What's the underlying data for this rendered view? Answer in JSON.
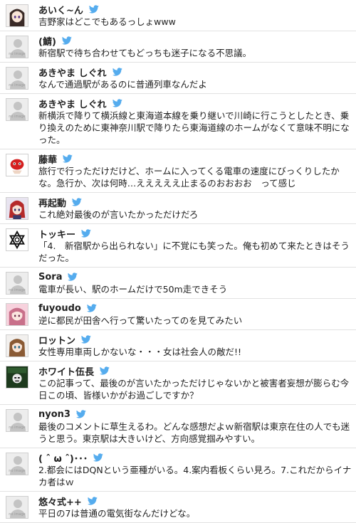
{
  "no_image_label": "no image",
  "tweets": [
    {
      "name": "あいく~ん",
      "text": "吉野家はどこでもあるっしょwww",
      "avatar": "anime-girl"
    },
    {
      "name": "(鯖)",
      "text": "新宿駅で待ち合わせてもどっちも迷子になる不思議。",
      "avatar": "noimage"
    },
    {
      "name": "あきやま しぐれ",
      "text": "なんで通過駅があるのに普通列車なんだよ",
      "avatar": "noimage"
    },
    {
      "name": "あきやま しぐれ",
      "text": "新横浜で降りて横浜線と東海道本線を乗り継いで川崎に行こうとしたとき、乗り換えのために東神奈川駅で降りたら東海道線のホームがなくて意味不明になった。",
      "avatar": "noimage"
    },
    {
      "name": "藤華",
      "text": "旅行で行っただけだけど、ホームに入ってくる電車の速度にびっくりしたかな。急行か、次は何時…えええええ止まるのおおおお　って感じ",
      "avatar": "red-character"
    },
    {
      "name": "再起動",
      "text": "これ絶対最後のが言いたかっただけだろ",
      "avatar": "red-hair-anime"
    },
    {
      "name": "トッキー",
      "text": "「4.　新宿駅から出られない」に不覚にも笑った。俺も初めて来たときはそうだった。",
      "avatar": "hexagram"
    },
    {
      "name": "Sora",
      "text": "電車が長い、駅のホームだけで50m走できそう",
      "avatar": "noimage"
    },
    {
      "name": "fuyoudo",
      "text": "逆に都民が田舎へ行って驚いたってのを見てみたい",
      "avatar": "pink-girl"
    },
    {
      "name": "ロットン",
      "text": "女性専用車両しかないな・・・女は社会人の敵だ!!",
      "avatar": "brown-hair-anime"
    },
    {
      "name": "ホワイト伍長",
      "text": "この記事って、最後のが言いたかっただけじゃないかと被害者妄想が膨らむ今日この頃、皆様いかがお過ごしですか？",
      "avatar": "dark-green"
    },
    {
      "name": "nyon3",
      "text": "最後のコメントに草生えるわ。どんな感想だよｗ新宿駅は東京在住の人でも迷うと思う。東京駅は大きいけど、方向感覚掴みやすい。",
      "avatar": "noimage"
    },
    {
      "name": "( ˆ ω ˆ)･･･",
      "text": "2.都会にはDQNという亜種がいる。4.案内看板くらい見ろ。7.これだからイナカ者はｗ",
      "avatar": "noimage"
    },
    {
      "name": "悠々式++",
      "text": "平日の7は普通の電気街なんだけどな。",
      "avatar": "noimage"
    }
  ],
  "colors": {
    "bird": "#55acee",
    "divider": "#e2e2e2",
    "text": "#222222"
  }
}
